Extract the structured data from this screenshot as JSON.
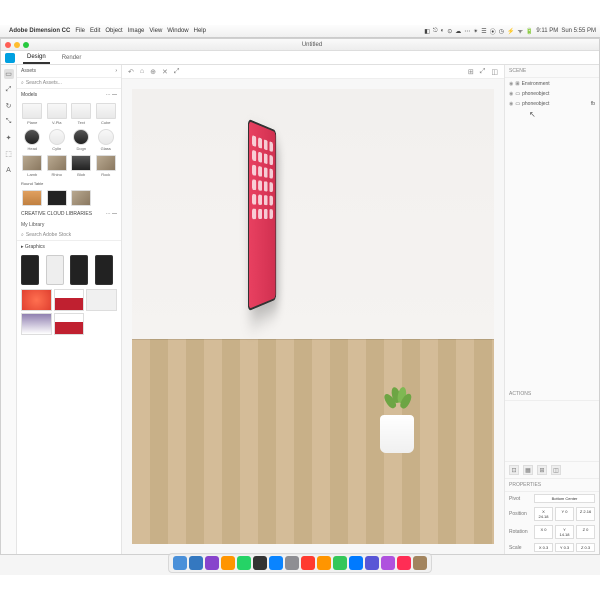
{
  "menubar": {
    "apple": "",
    "app_name": "Adobe Dimension CC",
    "items": [
      "File",
      "Edit",
      "Object",
      "Image",
      "View",
      "Window",
      "Help"
    ],
    "status_right": [
      "◧",
      "⎋",
      "◐",
      "⊙",
      "☁",
      "⋯",
      "✴",
      "☰",
      "⦿",
      "◷",
      "⚡",
      "ᯤ",
      "🔋",
      "9:11 PM",
      "Sun 5:55 PM"
    ]
  },
  "window": {
    "title": "Untitled"
  },
  "tabs": {
    "design": "Design",
    "render": "Render"
  },
  "tools": [
    "▭",
    "⤢",
    "↻",
    "⤡",
    "✦",
    "⬚",
    "A"
  ],
  "assets": {
    "head": "Assets",
    "search": "Search Assets...",
    "sections": {
      "models": "Models",
      "basic": [
        {
          "label": "Plane"
        },
        {
          "label": "V-Pla"
        },
        {
          "label": "Text"
        },
        {
          "label": "Cube"
        }
      ],
      "shapes": [
        {
          "label": "Head"
        },
        {
          "label": "Cylin"
        },
        {
          "label": "Dogn"
        },
        {
          "label": "Glass"
        }
      ],
      "more": [
        {
          "label": "Lamb"
        },
        {
          "label": "Rhino"
        },
        {
          "label": "Blob"
        },
        {
          "label": "Rock"
        }
      ],
      "round_table": "Round Table",
      "cc_libs": "CREATIVE CLOUD LIBRARIES",
      "my_library": "My Library",
      "search2": "Search Adobe Stock",
      "graphics": "▸ Graphics"
    }
  },
  "scene": {
    "head": "SCENE",
    "items": [
      {
        "icon": "⊞",
        "label": "Environment"
      },
      {
        "icon": "▭",
        "label": "phoneobject"
      },
      {
        "icon": "▭",
        "label": "phoneobject",
        "sub": "fb"
      }
    ]
  },
  "actions": {
    "head": "ACTIONS"
  },
  "properties": {
    "head": "PROPERTIES",
    "pivot_label": "Pivot",
    "pivot_value": "Bottom Center",
    "position_label": "Position",
    "position": [
      "X 24.18",
      "Y 0",
      "Z 2.16"
    ],
    "rotation_label": "Rotation",
    "rotation": [
      "X 0",
      "Y 14.18",
      "Z 0"
    ],
    "scale_label": "Scale",
    "scale": [
      "X 0.3",
      "Y 0.3",
      "Z 0.3"
    ]
  },
  "canvas_toolbar": {
    "left": [
      "↶",
      "⌂",
      "⊕",
      "✕",
      "⤢"
    ],
    "right": [
      "⊞",
      "⤢",
      "◫"
    ]
  },
  "dock_colors": [
    "#4a90d9",
    "#3478c0",
    "#8844cc",
    "#ff9500",
    "#25d366",
    "#333",
    "#0a84ff",
    "#8e8e93",
    "#ff3b30",
    "#ff9500",
    "#34c759",
    "#007aff",
    "#5856d6",
    "#af52de",
    "#ff2d55",
    "#a2845e"
  ]
}
